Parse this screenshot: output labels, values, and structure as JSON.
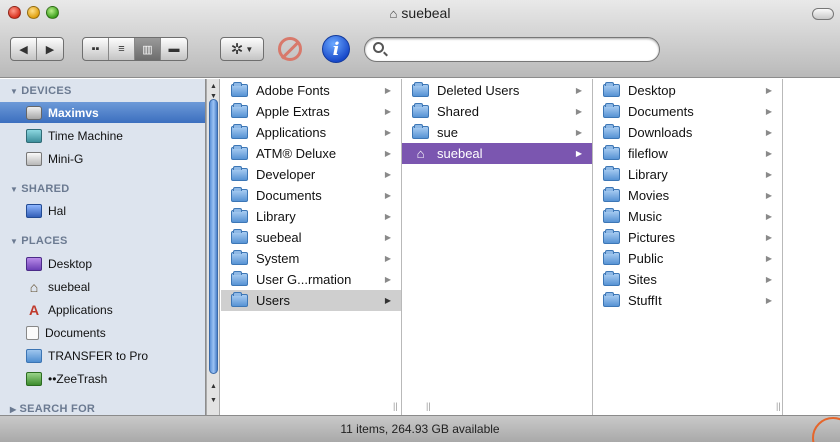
{
  "window": {
    "title": "suebeal"
  },
  "toolbar": {
    "back_glyph": "◀",
    "forward_glyph": "▶",
    "view_icons": [
      "▪▪",
      "≡",
      "▥",
      "▬"
    ],
    "action_glyph": "✲",
    "search": {
      "value": "",
      "placeholder": ""
    }
  },
  "sidebar": {
    "devices": {
      "header": "DEVICES",
      "items": [
        {
          "label": "Maximvs",
          "icon": "disk-icon",
          "selected": true
        },
        {
          "label": "Time Machine",
          "icon": "time-machine-icon"
        },
        {
          "label": "Mini-G",
          "icon": "computer-icon"
        }
      ]
    },
    "shared": {
      "header": "SHARED",
      "items": [
        {
          "label": "Hal",
          "icon": "network-computer-icon"
        }
      ]
    },
    "places": {
      "header": "PLACES",
      "items": [
        {
          "label": "Desktop",
          "icon": "desktop-icon"
        },
        {
          "label": "suebeal",
          "icon": "home-icon"
        },
        {
          "label": "Applications",
          "icon": "applications-icon"
        },
        {
          "label": "Documents",
          "icon": "document-icon"
        },
        {
          "label": "TRANSFER to Pro",
          "icon": "folder-icon"
        },
        {
          "label": "••ZeeTrash",
          "icon": "trash-folder-icon"
        }
      ]
    },
    "search_for": {
      "header": "SEARCH FOR"
    }
  },
  "columns": [
    {
      "items": [
        {
          "label": "Adobe Fonts"
        },
        {
          "label": "Apple Extras"
        },
        {
          "label": "Applications"
        },
        {
          "label": "ATM® Deluxe"
        },
        {
          "label": "Developer"
        },
        {
          "label": "Documents"
        },
        {
          "label": "Library"
        },
        {
          "label": "suebeal"
        },
        {
          "label": "System"
        },
        {
          "label": "User G...rmation"
        },
        {
          "label": "Users",
          "selected": "gray"
        }
      ]
    },
    {
      "items": [
        {
          "label": "Deleted Users"
        },
        {
          "label": "Shared"
        },
        {
          "label": "sue"
        },
        {
          "label": "suebeal",
          "selected": "purple"
        }
      ]
    },
    {
      "items": [
        {
          "label": "Desktop"
        },
        {
          "label": "Documents"
        },
        {
          "label": "Downloads"
        },
        {
          "label": "fileflow"
        },
        {
          "label": "Library"
        },
        {
          "label": "Movies"
        },
        {
          "label": "Music"
        },
        {
          "label": "Pictures"
        },
        {
          "label": "Public"
        },
        {
          "label": "Sites"
        },
        {
          "label": "StuffIt"
        }
      ]
    }
  ],
  "status": {
    "text": "11 items, 264.93 GB available"
  },
  "colors": {
    "selection_purple": "#7b56b0",
    "sidebar_bg": "#dde4ee",
    "sidebar_header": "#6b7a91",
    "grow_highlight": "#e5662c"
  }
}
